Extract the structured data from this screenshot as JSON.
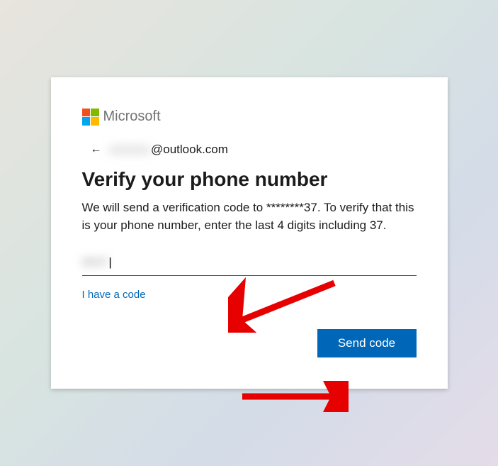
{
  "brand": {
    "name": "Microsoft"
  },
  "identity": {
    "emailMaskedPart": "xxxxxxx",
    "emailDomain": "@outlook.com"
  },
  "heading": "Verify your phone number",
  "description": "We will send a verification code to ********37. To verify that this is your phone number, enter the last 4 digits including 37.",
  "input": {
    "maskedValue": "0037"
  },
  "links": {
    "haveCode": "I have a code"
  },
  "buttons": {
    "sendCode": "Send code"
  }
}
